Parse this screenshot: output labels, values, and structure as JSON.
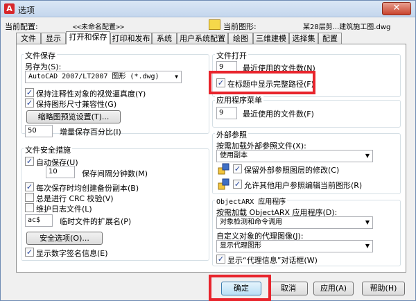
{
  "window": {
    "title": "选项",
    "close_glyph": "✕",
    "current_profile_label": "当前配置:",
    "current_profile_value": "<<未命名配置>>",
    "current_drawing_label": "当前图形:",
    "current_drawing_value": "某28层剪...建筑施工图.dwg"
  },
  "tabs": [
    {
      "label": "文件"
    },
    {
      "label": "显示"
    },
    {
      "label": "打开和保存"
    },
    {
      "label": "打印和发布"
    },
    {
      "label": "系统"
    },
    {
      "label": "用户系统配置"
    },
    {
      "label": "绘图"
    },
    {
      "label": "三维建模"
    },
    {
      "label": "选择集"
    },
    {
      "label": "配置"
    }
  ],
  "file_save": {
    "title": "文件保存",
    "save_as_label": "另存为(S):",
    "save_as_value": "AutoCAD 2007/LT2007 图形 (*.dwg)",
    "annotative_fidelity": "保持注释性对象的视觉逼真度(Y)",
    "drawing_size_compat": "保持图形尺寸兼容性(G)",
    "thumbnail_button": "缩略图预览设置(T)...",
    "incremental_value": "50",
    "incremental_label": "增量保存百分比(I)"
  },
  "file_safety": {
    "title": "文件安全措施",
    "autosave": "自动保存(U)",
    "autosave_minutes_value": "10",
    "autosave_minutes_label": "保存间隔分钟数(M)",
    "backup_copy": "每次保存时均创建备份副本(B)",
    "crc_check": "总是进行 CRC 校验(V)",
    "log_file": "维护日志文件(L)",
    "temp_ext_value": "ac$",
    "temp_ext_label": "临时文件的扩展名(P)",
    "security_button": "安全选项(O)...",
    "digital_signature": "显示数字签名信息(E)"
  },
  "file_open": {
    "title": "文件打开",
    "recent_value": "9",
    "recent_label": "最近使用的文件数(N)",
    "full_path": "在标题中显示完整路径(F)"
  },
  "app_menu": {
    "title": "应用程序菜单",
    "recent_value": "9",
    "recent_label": "最近使用的文件数(F)"
  },
  "xref": {
    "title": "外部参照",
    "demand_load_label": "按需加载外部参照文件(X):",
    "demand_load_value": "使用副本",
    "retain_changes": "保留外部参照图层的修改(C)",
    "allow_edit": "允许其他用户参照编辑当前图形(R)"
  },
  "objectarx": {
    "title": "ObjectARX 应用程序",
    "demand_load_label": "按需加载 ObjectARX 应用程序(D):",
    "demand_load_value": "对象检测和命令调用",
    "proxy_label": "自定义对象的代理图像(J):",
    "proxy_value": "显示代理图形",
    "proxy_dialog": "显示“代理信息”对话框(W)"
  },
  "buttons": {
    "ok": "确定",
    "cancel": "取消",
    "apply": "应用(A)",
    "help": "帮助(H)"
  },
  "checks": {
    "checked": "✓",
    "arrow": "▼"
  },
  "colors": {
    "highlight": "#e8242c",
    "title_bar": "#c4d6ed"
  }
}
